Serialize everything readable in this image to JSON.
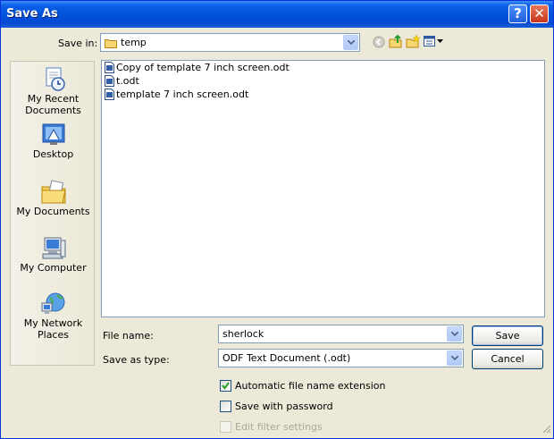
{
  "window": {
    "title": "Save As"
  },
  "title_buttons": {
    "help": "?",
    "close": "✕"
  },
  "savein": {
    "label": "Save in:",
    "folder": "temp"
  },
  "toolbar": {
    "back_icon": "back-icon",
    "up_icon": "up-folder-icon",
    "new_icon": "new-folder-icon",
    "views_icon": "views-menu-icon"
  },
  "places": [
    {
      "label": "My Recent Documents",
      "icon": "recent-documents-icon"
    },
    {
      "label": "Desktop",
      "icon": "desktop-icon"
    },
    {
      "label": "My Documents",
      "icon": "my-documents-icon"
    },
    {
      "label": "My Computer",
      "icon": "my-computer-icon"
    },
    {
      "label": "My Network Places",
      "icon": "network-places-icon"
    }
  ],
  "files": [
    {
      "name": "Copy of template 7 inch screen.odt"
    },
    {
      "name": "t.odt"
    },
    {
      "name": "template 7 inch screen.odt"
    }
  ],
  "filename": {
    "label": "File name:",
    "value": "sherlock"
  },
  "filetype": {
    "label": "Save as type:",
    "value": "ODF Text Document (.odt)"
  },
  "buttons": {
    "save": "Save",
    "cancel": "Cancel"
  },
  "options": {
    "auto_ext": {
      "label": "Automatic file name extension",
      "checked": true
    },
    "password": {
      "label": "Save with password",
      "checked": false
    },
    "filter": {
      "label": "Edit filter settings",
      "checked": false,
      "disabled": true
    }
  }
}
